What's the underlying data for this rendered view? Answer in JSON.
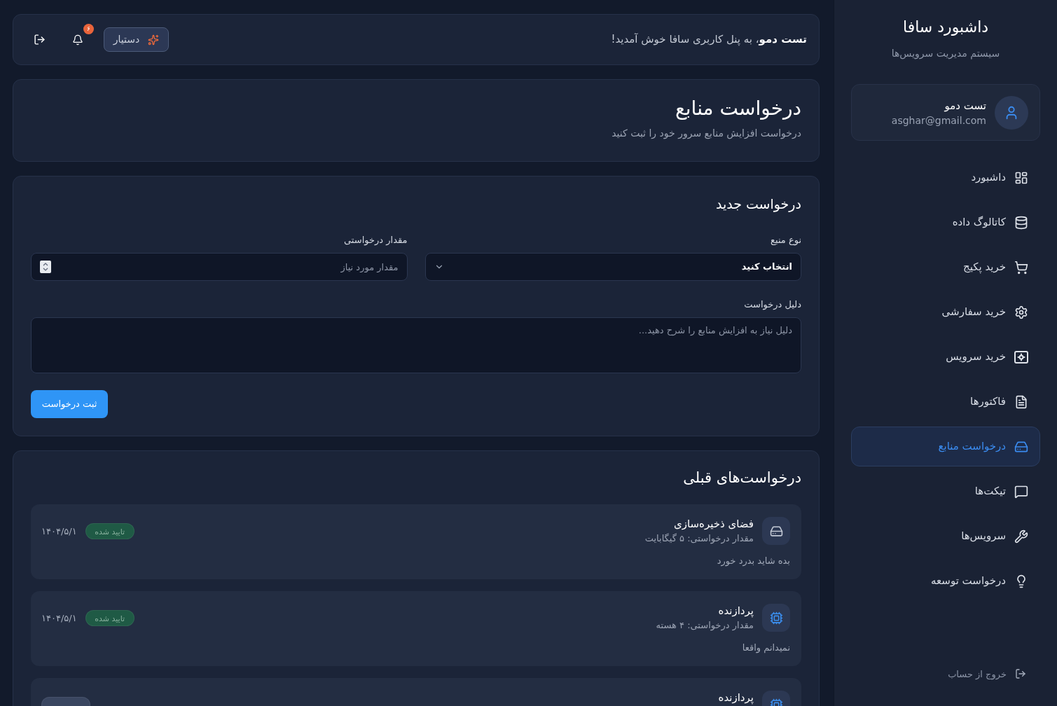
{
  "sidebar": {
    "title": "داشبورد سافا",
    "subtitle": "سیستم مدیریت سرویس‌ها",
    "user": {
      "name": "تست دمو",
      "email": "asghar@gmail.com"
    },
    "items": [
      {
        "label": "داشبورد",
        "selected": false
      },
      {
        "label": "کاتالوگ داده",
        "selected": false
      },
      {
        "label": "خرید پکیج",
        "selected": false
      },
      {
        "label": "خرید سفارشی",
        "selected": false
      },
      {
        "label": "خرید سرویس",
        "selected": false
      },
      {
        "label": "فاکتورها",
        "selected": false
      },
      {
        "label": "درخواست منابع",
        "selected": true
      },
      {
        "label": "تیکت‌ها",
        "selected": false
      },
      {
        "label": "سرویس‌ها",
        "selected": false
      },
      {
        "label": "درخواست توسعه",
        "selected": false
      }
    ],
    "logout": "خروج از حساب"
  },
  "header": {
    "greeting": "**تست دمو**، به پنل کاربری سافا خوش آمدید!",
    "assistant_button": "دستیار",
    "notification_count": "۶"
  },
  "page": {
    "title": "درخواست منابع",
    "subtitle": "درخواست افزایش منابع سرور خود را ثبت کنید"
  },
  "new_request": {
    "title": "درخواست جدید",
    "fields": [
      {
        "kind": "select",
        "label": "نوع منبع",
        "value": "انتخاب کنید"
      },
      {
        "kind": "number",
        "label": "مقدار درخواستی",
        "placeholder": "مقدار مورد نیاز"
      },
      {
        "kind": "textarea",
        "label": "دلیل درخواست",
        "placeholder": "دلیل نیاز به افزایش منابع را شرح دهید..."
      }
    ],
    "submit": "ثبت درخواست"
  },
  "previous_requests": {
    "title": "درخواست‌های قبلی",
    "items": [
      {
        "kind": "storage",
        "title": "فضای ذخیره‌سازی",
        "amount": "مقدار درخواستی: ۵ گیگابایت",
        "note": "بده شاید بدرد خورد",
        "status": {
          "label": "تایید شده",
          "color": "#1f5a45"
        },
        "date": "۱۴۰۴/۵/۱"
      },
      {
        "kind": "cpu",
        "title": "پردازنده",
        "amount": "مقدار درخواستی: ۴ هسته",
        "note": "نمیدانم واقعا",
        "status": {
          "label": "تایید شده",
          "color": "#1f5a45"
        },
        "date": "۱۴۰۴/۵/۱"
      },
      {
        "kind": "cpu",
        "title": "پردازنده",
        "status": {
          "color": "#3a4660"
        }
      }
    ]
  }
}
